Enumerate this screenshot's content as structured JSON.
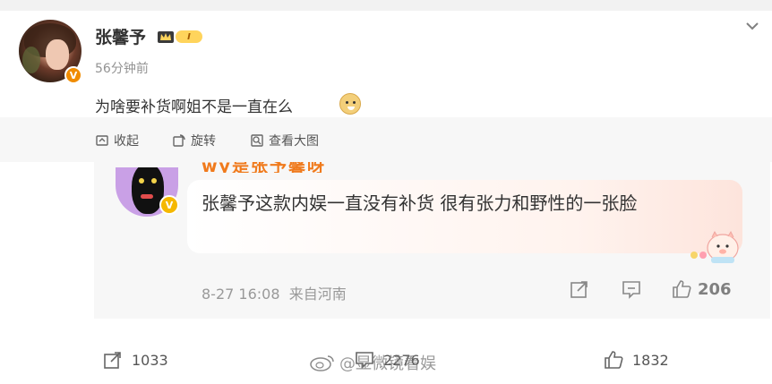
{
  "post": {
    "username": "张馨予",
    "level_badge": "I",
    "time": "56分钟前",
    "text": "为啥要补货啊姐不是一直在么",
    "emoji": "doge-emoji",
    "toolbar": {
      "collapse": "收起",
      "rotate": "旋转",
      "view_large": "查看大图"
    }
  },
  "card": {
    "cropped_name": "wy是张予馨呀",
    "text": "张馨予这款内娱一直没有补货 很有张力和野性的一张脸",
    "date": "8-27 16:08",
    "source": "来自河南",
    "likes": "206"
  },
  "actions": {
    "share_count": "1033",
    "comment_count": "2276",
    "like_count": "1832"
  },
  "watermark": "@显微镜看娱",
  "colors": {
    "accent_orange": "#f08c00",
    "verified_yellow": "#f5b800",
    "text": "#333333",
    "muted": "#939393"
  },
  "icons": [
    "chevron-down-icon",
    "collapse-icon",
    "rotate-icon",
    "zoom-icon",
    "share-icon",
    "comment-icon",
    "like-icon"
  ]
}
